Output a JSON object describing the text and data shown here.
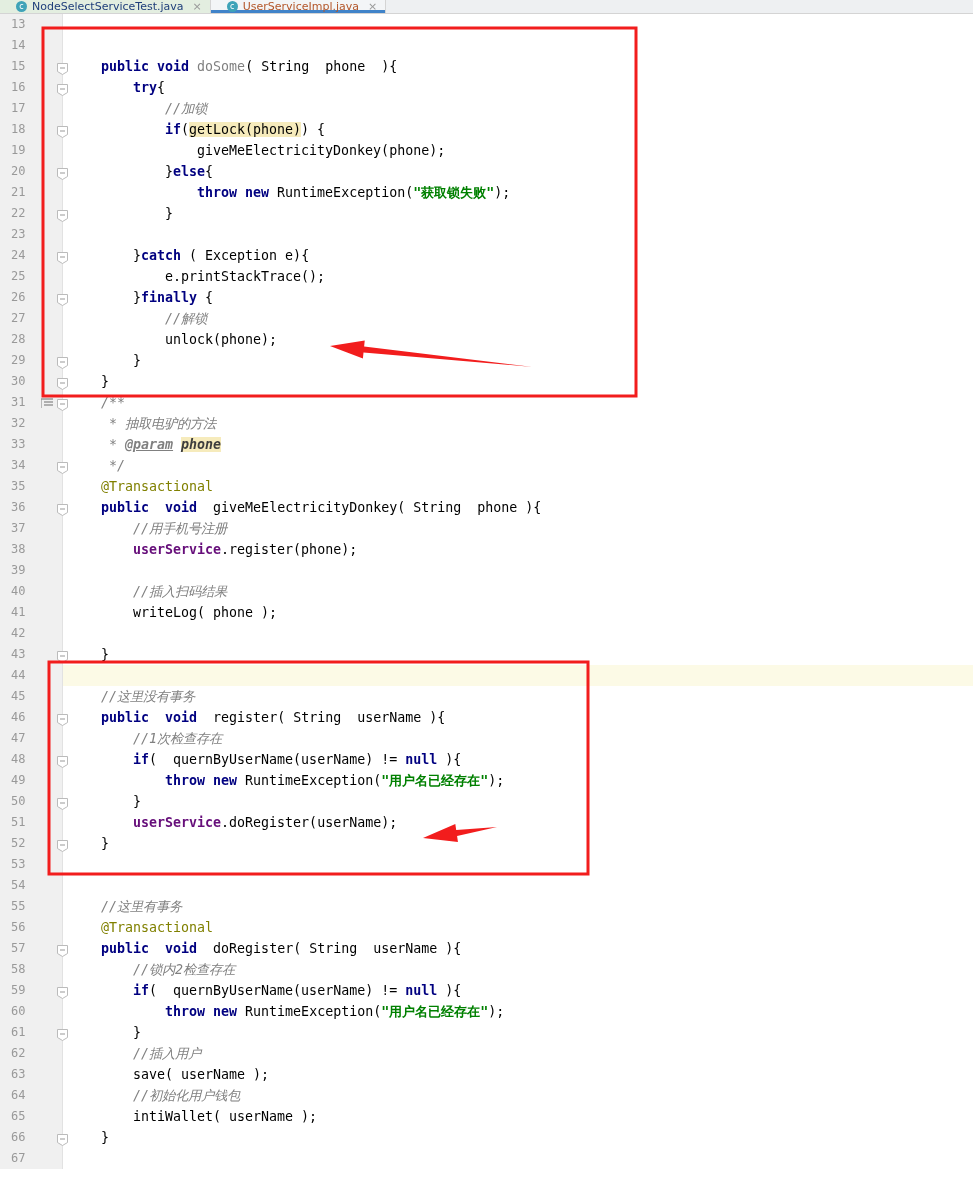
{
  "tabs": [
    {
      "icon_letter": "c",
      "label": "NodeSelectServiceTest.java",
      "close": "×",
      "selected": false
    },
    {
      "icon_letter": "c",
      "label": "UserServiceImpl.java",
      "close": "×",
      "selected": true
    }
  ],
  "editor": {
    "lines": [
      {
        "number": "13",
        "fold": false,
        "current": false
      },
      {
        "number": "14",
        "fold": false,
        "current": false
      },
      {
        "number": "15",
        "fold": true,
        "current": false,
        "tokens": [
          {
            "kind": "kw",
            "text": "public "
          },
          {
            "kind": "kw",
            "text": "void "
          },
          {
            "kind": "unused",
            "text": "doSome"
          },
          {
            "kind": "plain",
            "text": "( String  phone  ){"
          }
        ],
        "children": [
          {
            "number": "16",
            "fold": true,
            "current": false,
            "tokens": [
              {
                "kind": "kw",
                "text": "try"
              },
              {
                "kind": "plain",
                "text": "{"
              }
            ],
            "children": [
              {
                "number": "17",
                "fold": false,
                "current": false,
                "tokens": [
                  {
                    "kind": "comment",
                    "text": "//加锁"
                  }
                ]
              },
              {
                "number": "18",
                "fold": true,
                "current": false,
                "tokens": [
                  {
                    "kind": "kw",
                    "text": "if"
                  },
                  {
                    "kind": "plain",
                    "text": "("
                  },
                  {
                    "kind": "hl",
                    "text": "getLock(phone)"
                  },
                  {
                    "kind": "plain",
                    "text": ") {"
                  }
                ],
                "children": [
                  {
                    "number": "19",
                    "fold": false,
                    "current": false,
                    "tokens": [
                      {
                        "kind": "plain",
                        "text": "giveMeElectricityDonkey(phone);"
                      }
                    ]
                  }
                ]
              },
              {
                "number": "20",
                "fold": true,
                "current": false,
                "tokens": [
                  {
                    "kind": "plain",
                    "text": "}"
                  },
                  {
                    "kind": "kw",
                    "text": "else"
                  },
                  {
                    "kind": "plain",
                    "text": "{"
                  }
                ],
                "children": [
                  {
                    "number": "21",
                    "fold": false,
                    "current": false,
                    "tokens": [
                      {
                        "kind": "kw",
                        "text": "throw "
                      },
                      {
                        "kind": "kw",
                        "text": "new"
                      },
                      {
                        "kind": "plain",
                        "text": " RuntimeException("
                      },
                      {
                        "kind": "str",
                        "text": "\"获取锁失败\""
                      },
                      {
                        "kind": "plain",
                        "text": ");"
                      }
                    ]
                  }
                ]
              },
              {
                "number": "22",
                "fold": true,
                "current": false,
                "tokens": [
                  {
                    "kind": "plain",
                    "text": "}"
                  }
                ]
              },
              {
                "number": "23",
                "fold": false,
                "current": false
              }
            ]
          },
          {
            "number": "24",
            "fold": true,
            "current": false,
            "tokens": [
              {
                "kind": "plain",
                "text": "}"
              },
              {
                "kind": "kw",
                "text": "catch"
              },
              {
                "kind": "plain",
                "text": " ( Exception e){"
              }
            ],
            "children": [
              {
                "number": "25",
                "fold": false,
                "current": false,
                "tokens": [
                  {
                    "kind": "plain",
                    "text": "e.printStackTrace();"
                  }
                ]
              }
            ]
          },
          {
            "number": "26",
            "fold": true,
            "current": false,
            "tokens": [
              {
                "kind": "plain",
                "text": "}"
              },
              {
                "kind": "kw",
                "text": "finally"
              },
              {
                "kind": "plain",
                "text": " {"
              }
            ],
            "children": [
              {
                "number": "27",
                "fold": false,
                "current": false,
                "tokens": [
                  {
                    "kind": "comment",
                    "text": "//解锁"
                  }
                ]
              },
              {
                "number": "28",
                "fold": false,
                "current": false,
                "tokens": [
                  {
                    "kind": "plain",
                    "text": "unlock(phone);"
                  }
                ]
              }
            ]
          },
          {
            "number": "29",
            "fold": true,
            "current": false,
            "tokens": [
              {
                "kind": "plain",
                "text": "}"
              }
            ]
          }
        ]
      },
      {
        "number": "30",
        "fold": true,
        "current": false,
        "tokens": [
          {
            "kind": "plain",
            "text": "}"
          }
        ]
      },
      {
        "number": "31",
        "fold": true,
        "current": false,
        "doc_toggle": true,
        "tokens": [
          {
            "kind": "comment",
            "text": "/**"
          }
        ]
      },
      {
        "number": "32",
        "fold": false,
        "current": false,
        "tokens": [
          {
            "kind": "comment",
            "text": " * 抽取电驴的方法"
          }
        ]
      },
      {
        "number": "33",
        "fold": false,
        "current": false,
        "tokens": [
          {
            "kind": "comment",
            "text": " *"
          },
          {
            "kind": "doctag",
            "text": "@param"
          },
          {
            "kind": "docparam",
            "text": "phone"
          }
        ]
      },
      {
        "number": "34",
        "fold": true,
        "current": false,
        "tokens": [
          {
            "kind": "comment",
            "text": " */"
          }
        ]
      },
      {
        "number": "35",
        "fold": false,
        "current": false,
        "tokens": [
          {
            "kind": "ann",
            "text": "@Transactional"
          }
        ]
      },
      {
        "number": "36",
        "fold": true,
        "current": false,
        "tokens": [
          {
            "kind": "kw",
            "text": "public  "
          },
          {
            "kind": "kw",
            "text": "void"
          },
          {
            "kind": "plain",
            "text": "  giveMeElectricityDonkey( String  phone ){"
          }
        ],
        "children": [
          {
            "number": "37",
            "fold": false,
            "current": false,
            "tokens": [
              {
                "kind": "comment",
                "text": "//用手机号注册"
              }
            ]
          },
          {
            "number": "38",
            "fold": false,
            "current": false,
            "tokens": [
              {
                "kind": "field",
                "text": "userService"
              },
              {
                "kind": "plain",
                "text": ".register(phone);"
              }
            ]
          },
          {
            "number": "39",
            "fold": false,
            "current": false
          },
          {
            "number": "40",
            "fold": false,
            "current": false,
            "tokens": [
              {
                "kind": "comment",
                "text": "//插入扫码结果"
              }
            ]
          },
          {
            "number": "41",
            "fold": false,
            "current": false,
            "tokens": [
              {
                "kind": "plain",
                "text": "writeLog( phone );"
              }
            ]
          },
          {
            "number": "42",
            "fold": false,
            "current": false
          }
        ]
      },
      {
        "number": "43",
        "fold": true,
        "current": false,
        "tokens": [
          {
            "kind": "plain",
            "text": "}"
          }
        ]
      },
      {
        "number": "44",
        "fold": false,
        "current": true
      },
      {
        "number": "45",
        "fold": false,
        "current": false,
        "tokens": [
          {
            "kind": "comment",
            "text": "//这里没有事务"
          }
        ]
      },
      {
        "number": "46",
        "fold": true,
        "current": false,
        "tokens": [
          {
            "kind": "kw",
            "text": "public  "
          },
          {
            "kind": "kw",
            "text": "void"
          },
          {
            "kind": "plain",
            "text": "  register( String  userName ){"
          }
        ],
        "children": [
          {
            "number": "47",
            "fold": false,
            "current": false,
            "tokens": [
              {
                "kind": "comment",
                "text": "//1次检查存在"
              }
            ]
          },
          {
            "number": "48",
            "fold": true,
            "current": false,
            "tokens": [
              {
                "kind": "kw",
                "text": "if"
              },
              {
                "kind": "plain",
                "text": "(  quernByUserName(userName) != "
              },
              {
                "kind": "kw",
                "text": "null"
              },
              {
                "kind": "plain",
                "text": " ){"
              }
            ],
            "children": [
              {
                "number": "49",
                "fold": false,
                "current": false,
                "tokens": [
                  {
                    "kind": "kw",
                    "text": "throw "
                  },
                  {
                    "kind": "kw",
                    "text": "new"
                  },
                  {
                    "kind": "plain",
                    "text": " RuntimeException("
                  },
                  {
                    "kind": "str",
                    "text": "\"用户名已经存在\""
                  },
                  {
                    "kind": "plain",
                    "text": ");"
                  }
                ]
              }
            ]
          },
          {
            "number": "50",
            "fold": true,
            "current": false,
            "tokens": [
              {
                "kind": "plain",
                "text": "}"
              }
            ]
          },
          {
            "number": "51",
            "fold": false,
            "current": false,
            "tokens": [
              {
                "kind": "field",
                "text": "userService"
              },
              {
                "kind": "plain",
                "text": ".doRegister(userName);"
              }
            ]
          }
        ]
      },
      {
        "number": "52",
        "fold": true,
        "current": false,
        "tokens": [
          {
            "kind": "plain",
            "text": "}"
          }
        ]
      },
      {
        "number": "53",
        "fold": false,
        "current": false
      },
      {
        "number": "54",
        "fold": false,
        "current": false
      },
      {
        "number": "55",
        "fold": false,
        "current": false,
        "tokens": [
          {
            "kind": "comment",
            "text": "//这里有事务"
          }
        ]
      },
      {
        "number": "56",
        "fold": false,
        "current": false,
        "tokens": [
          {
            "kind": "ann",
            "text": "@Transactional"
          }
        ]
      },
      {
        "number": "57",
        "fold": true,
        "current": false,
        "tokens": [
          {
            "kind": "kw",
            "text": "public  "
          },
          {
            "kind": "kw",
            "text": "void"
          },
          {
            "kind": "plain",
            "text": "  doRegister( String  userName ){"
          }
        ],
        "children": [
          {
            "number": "58",
            "fold": false,
            "current": false,
            "tokens": [
              {
                "kind": "comment",
                "text": "//锁内2检查存在"
              }
            ]
          },
          {
            "number": "59",
            "fold": true,
            "current": false,
            "tokens": [
              {
                "kind": "kw",
                "text": "if"
              },
              {
                "kind": "plain",
                "text": "(  quernByUserName(userName) != "
              },
              {
                "kind": "kw",
                "text": "null"
              },
              {
                "kind": "plain",
                "text": " ){"
              }
            ],
            "children": [
              {
                "number": "60",
                "fold": false,
                "current": false,
                "tokens": [
                  {
                    "kind": "kw",
                    "text": "throw "
                  },
                  {
                    "kind": "kw",
                    "text": "new"
                  },
                  {
                    "kind": "plain",
                    "text": " RuntimeException("
                  },
                  {
                    "kind": "str",
                    "text": "\"用户名已经存在\""
                  },
                  {
                    "kind": "plain",
                    "text": ");"
                  }
                ]
              }
            ]
          },
          {
            "number": "61",
            "fold": true,
            "current": false,
            "tokens": [
              {
                "kind": "plain",
                "text": "}"
              }
            ]
          },
          {
            "number": "62",
            "fold": false,
            "current": false,
            "tokens": [
              {
                "kind": "comment",
                "text": "//插入用户"
              }
            ]
          },
          {
            "number": "63",
            "fold": false,
            "current": false,
            "tokens": [
              {
                "kind": "plain",
                "text": "save( userName );"
              }
            ]
          },
          {
            "number": "64",
            "fold": false,
            "current": false,
            "tokens": [
              {
                "kind": "comment",
                "text": "//初始化用户钱包"
              }
            ]
          },
          {
            "number": "65",
            "fold": false,
            "current": false,
            "tokens": [
              {
                "kind": "plain",
                "text": "intiWallet( userName );"
              }
            ]
          }
        ]
      },
      {
        "number": "66",
        "fold": true,
        "current": false,
        "tokens": [
          {
            "kind": "plain",
            "text": "}"
          }
        ]
      },
      {
        "number": "67",
        "fold": false,
        "current": false
      }
    ]
  },
  "markup": [
    {
      "kind": "frame"
    },
    {
      "kind": "arrow"
    },
    {
      "kind": "frame"
    },
    {
      "kind": "arrow"
    }
  ]
}
